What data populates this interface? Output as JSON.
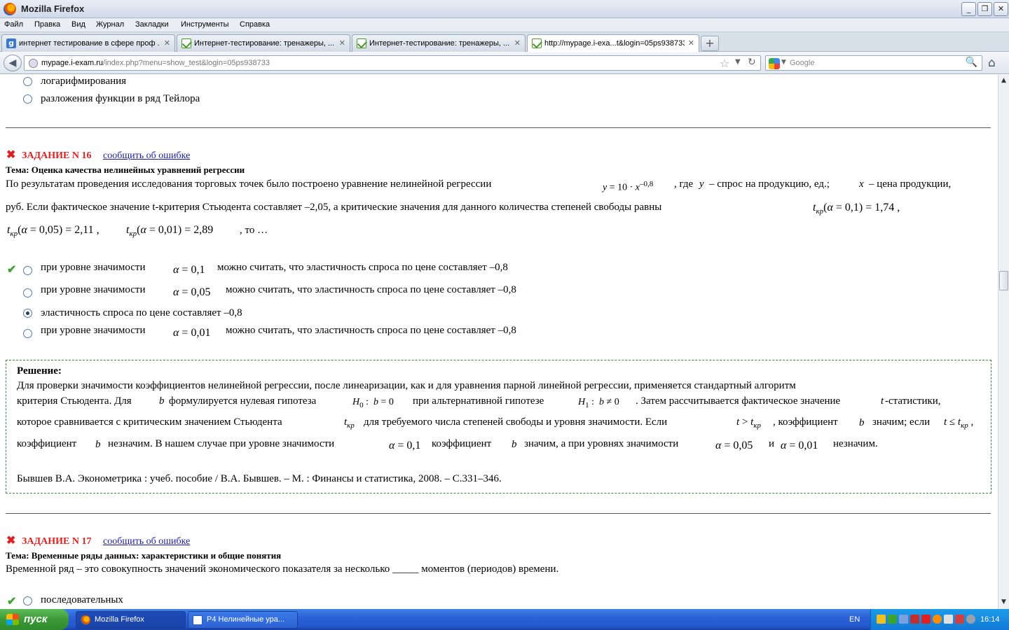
{
  "window": {
    "title": "Mozilla Firefox",
    "min_label": "_",
    "max_label": "❐",
    "close_label": "✕"
  },
  "menu": [
    "Файл",
    "Правка",
    "Вид",
    "Журнал",
    "Закладки",
    "Инструменты",
    "Справка"
  ],
  "tabs": [
    {
      "label": "интернет тестирование в сфере проф ...",
      "icon": "google-favicon",
      "close": "✕"
    },
    {
      "label": "Интернет-тестирование: тренажеры, ...",
      "icon": "i-exam-favicon",
      "close": "✕"
    },
    {
      "label": "Интернет-тестирование: тренажеры, ...",
      "icon": "i-exam-favicon",
      "close": "✕"
    },
    {
      "label": "http://mypage.i-exa...t&login=05ps938733",
      "icon": "i-exam-favicon",
      "close": "✕"
    }
  ],
  "newtab_label": "+",
  "nav": {
    "url_host": "mypage.i-exam.ru",
    "url_path": "/index.php?menu=show_test&login=05ps938733",
    "search_placeholder": "Google"
  },
  "page": {
    "prev_options": [
      "логарифмирования",
      "разложения функции в ряд Тейлора"
    ],
    "task16": {
      "title": "ЗАДАНИЕ N 16",
      "report_link": "сообщить об ошибке",
      "topic": "Тема: Оценка качества нелинейных уравнений регрессии",
      "q1": "По результатам проведения исследования торговых точек было построено уравнение нелинейной регрессии",
      "q1b": ", где",
      "q1c": "– спрос на продукцию, ед.;",
      "q1d": "– цена продукции,",
      "q2": "руб. Если фактическое значение t-критерия Стьюдента составляет  –2,05, а критические значения для данного количества степеней свободы равны",
      "q3_end": ", то …",
      "options": [
        {
          "pre": "при уровне значимости",
          "alpha": "0,1",
          "post": "можно считать, что эластичность спроса по цене составляет  –0,8",
          "correct": true,
          "selected": false
        },
        {
          "pre": "при уровне значимости",
          "alpha": "0,05",
          "post": "можно считать, что эластичность спроса по цене составляет  –0,8",
          "correct": false,
          "selected": false
        },
        {
          "pre": "эластичность спроса по цене составляет  –0,8",
          "alpha": "",
          "post": "",
          "correct": false,
          "selected": true
        },
        {
          "pre": "при уровне значимости",
          "alpha": "0,01",
          "post": "можно считать, что эластичность спроса по цене составляет  –0,8",
          "correct": false,
          "selected": false
        }
      ],
      "solution": {
        "heading": "Решение:",
        "l1": "Для проверки значимости коэффициентов нелинейной регрессии, после линеаризации, как и для уравнения парной линейной регрессии, применяется стандартный алгоритм",
        "l2a": "критерия Стьюдента. Для",
        "l2b": "формулируется нулевая гипотеза",
        "l2c": "при альтернативной гипотезе",
        "l2d": ". Затем рассчитывается фактическое значение",
        "l2e": "-статистики,",
        "l3a": "которое сравнивается с критическим значением Стьюдента",
        "l3b": "для требуемого числа степеней свободы и уровня значимости. Если",
        "l3c": ", коэффициент",
        "l3d": "значим; если",
        "l4a": "коэффициент",
        "l4b": "незначим. В нашем случае при уровне значимости",
        "l4c": "коэффициент",
        "l4d": "значим, а при уровнях значимости",
        "l4e": "и",
        "l4f": "незначим.",
        "ref": "Бывшев В.А. Эконометрика : учеб. пособие / В.А. Бывшев. – М. : Финансы и статистика, 2008. – С.331–346."
      }
    },
    "task17": {
      "title": "ЗАДАНИЕ N 17",
      "report_link": "сообщить об ошибке",
      "topic": "Тема: Временные ряды данных: характеристики и общие понятия",
      "question": "Временной ряд – это совокупность значений экономического показателя за несколько _____ моментов (периодов) времени.",
      "option1": "последовательных"
    }
  },
  "taskbar": {
    "start": "пуск",
    "items": [
      "Mozilla Firefox",
      "Р4 Нелинейные ура..."
    ],
    "lang": "EN",
    "clock": "16:14"
  },
  "colors": {
    "task_red": "#e02020",
    "check_green": "#3da32f",
    "link_blue": "#1a1aa6",
    "solution_border": "#3b8a3b"
  }
}
